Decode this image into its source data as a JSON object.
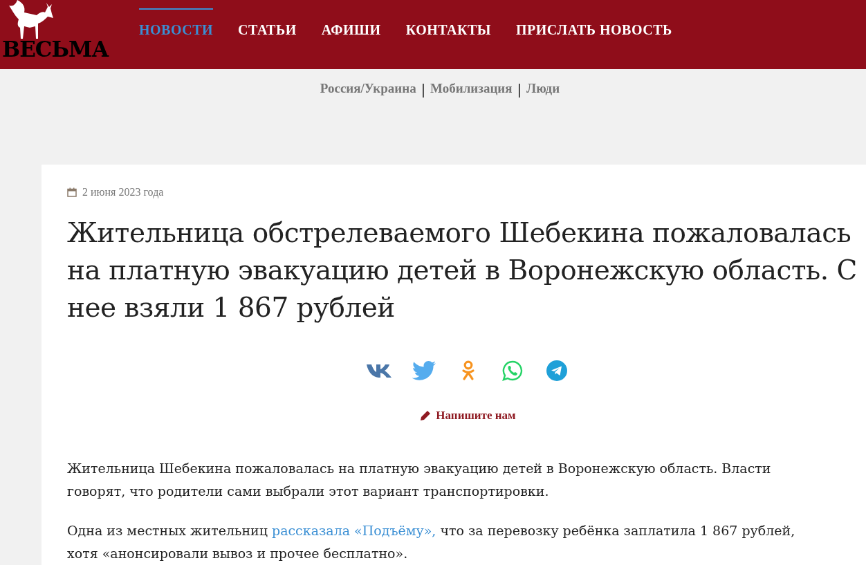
{
  "logo": {
    "text": "ВЕСЬМА"
  },
  "nav": [
    {
      "label": "НОВОСТИ",
      "selected": true
    },
    {
      "label": "СТАТЬИ",
      "selected": false
    },
    {
      "label": "АФИШИ",
      "selected": false
    },
    {
      "label": "КОНТАКТЫ",
      "selected": false
    },
    {
      "label": "ПРИСЛАТЬ НОВОСТЬ",
      "selected": false
    }
  ],
  "tags": [
    {
      "label": "Россия/Украина",
      "separator": "|"
    },
    {
      "label": "Мобилизация",
      "separator": "|"
    },
    {
      "label": "Люди"
    }
  ],
  "article": {
    "date": "2 июня 2023 года",
    "title": "Жительница обстрелеваемого Шебекина пожаловалась на платную эвакуацию детей в Воронежскую область. С нее взяли 1 867 рублей",
    "share": [
      {
        "kind": "vk"
      },
      {
        "kind": "twitter"
      },
      {
        "kind": "ok"
      },
      {
        "kind": "whatsapp"
      },
      {
        "kind": "telegram"
      }
    ],
    "contact": "Напишите нам",
    "paragraphs": [
      {
        "text": "Жительница Шебекина пожаловалась на платную эвакуацию детей в Воронежскую область. Власти говорят, что родители сами выбрали этот вариант транспортировки."
      },
      {
        "before": "Одна из местных жительниц ",
        "link": "рассказала «Подъёму»,",
        "after": " что за перевозку ребёнка заплатила 1 867 рублей, хотя «анонсировали вывоз и прочее бесплатно»."
      }
    ]
  }
}
